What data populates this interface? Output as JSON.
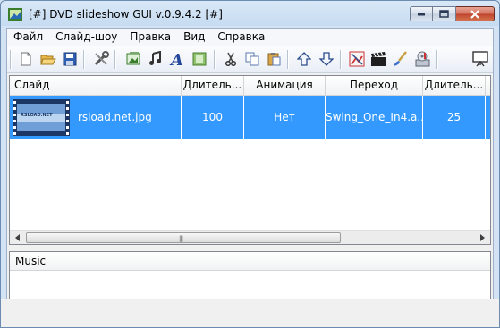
{
  "window": {
    "title": "[#] DVD slideshow GUI v.0.9.4.2 [#]"
  },
  "menu": [
    "Файл",
    "Слайд-шоу",
    "Правка",
    "Вид",
    "Справка"
  ],
  "toolbar_icons": [
    "new-file-icon",
    "open-folder-icon",
    "save-icon",
    "tools-icon",
    "add-image-icon",
    "add-audio-icon",
    "add-text-icon",
    "add-frame-icon",
    "cut-icon",
    "copy-icon",
    "paste-icon",
    "move-up-icon",
    "move-down-icon",
    "picture-icon",
    "clapperboard-icon",
    "brush-icon",
    "burn-disc-icon",
    "slideshow-presentation-icon"
  ],
  "grid": {
    "columns": [
      "Слайд",
      "Длитель...",
      "Анимация",
      "Переход",
      "Длитель..."
    ],
    "rows": [
      {
        "slide": "rsload.net.jpg",
        "duration": "100",
        "animation": "Нет",
        "transition": "Swing_One_In4.a...",
        "transition_duration": "25"
      }
    ]
  },
  "thumbnail_text": "RSLOAD.NET",
  "music": {
    "header": "Music"
  },
  "colors": {
    "selection": "#3399ff",
    "title_bar": "#c6dbf1",
    "close_button": "#c0442c"
  }
}
